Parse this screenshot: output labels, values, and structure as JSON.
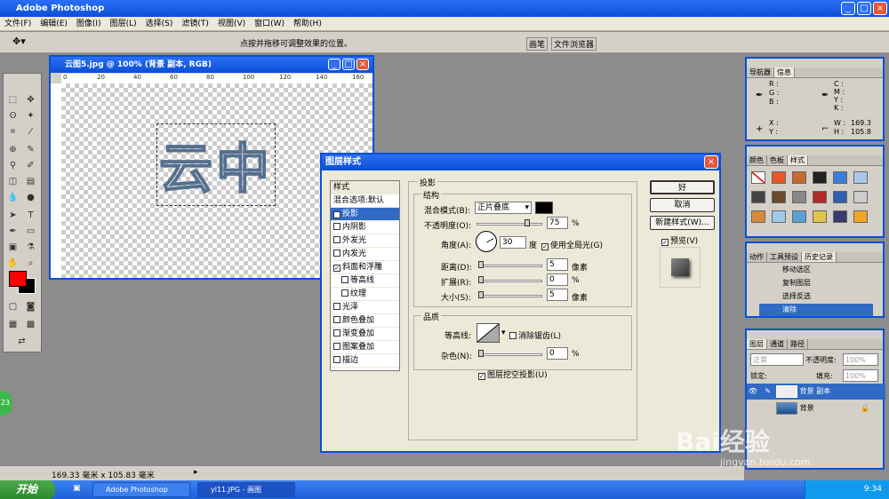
{
  "app": {
    "title": "Adobe Photoshop"
  },
  "menu": [
    "文件(F)",
    "编辑(E)",
    "图像(I)",
    "图层(L)",
    "选择(S)",
    "滤镜(T)",
    "视图(V)",
    "窗口(W)",
    "帮助(H)"
  ],
  "options": {
    "hint": "点按并拖移可调整效果的位置。",
    "tab_brush": "画笔",
    "tab_filebrowser": "文件浏览器"
  },
  "document": {
    "title": "云图5.jpg @ 100% (背景 副本, RGB)",
    "ruler": [
      "0",
      "20",
      "40",
      "60",
      "80",
      "100",
      "120",
      "140",
      "160"
    ],
    "art_text": "云中"
  },
  "dialog": {
    "title": "图层样式",
    "styles_header": "样式",
    "styles": [
      {
        "label": "混合选项:默认",
        "check": false,
        "active": false,
        "indent": false
      },
      {
        "label": "投影",
        "check": true,
        "checked": true,
        "active": true,
        "indent": false
      },
      {
        "label": "内阴影",
        "check": true,
        "checked": false,
        "active": false,
        "indent": false
      },
      {
        "label": "外发光",
        "check": true,
        "checked": false,
        "active": false,
        "indent": false
      },
      {
        "label": "内发光",
        "check": true,
        "checked": false,
        "active": false,
        "indent": false
      },
      {
        "label": "斜面和浮雕",
        "check": true,
        "checked": true,
        "active": false,
        "indent": false
      },
      {
        "label": "等高线",
        "check": true,
        "checked": false,
        "active": false,
        "indent": true
      },
      {
        "label": "纹理",
        "check": true,
        "checked": false,
        "active": false,
        "indent": true
      },
      {
        "label": "光泽",
        "check": true,
        "checked": false,
        "active": false,
        "indent": false
      },
      {
        "label": "颜色叠加",
        "check": true,
        "checked": false,
        "active": false,
        "indent": false
      },
      {
        "label": "渐变叠加",
        "check": true,
        "checked": false,
        "active": false,
        "indent": false
      },
      {
        "label": "图案叠加",
        "check": true,
        "checked": false,
        "active": false,
        "indent": false
      },
      {
        "label": "描边",
        "check": true,
        "checked": false,
        "active": false,
        "indent": false
      }
    ],
    "section": "投影",
    "structure": "结构",
    "blend_label": "混合模式(B):",
    "blend_value": "正片叠底",
    "opacity_label": "不透明度(O):",
    "opacity_value": "75",
    "percent": "%",
    "angle_label": "角度(A):",
    "angle_value": "30",
    "degree": "度",
    "global_light": "使用全局光(G)",
    "distance_label": "距离(D):",
    "distance_value": "5",
    "pixel": "像素",
    "spread_label": "扩展(R):",
    "spread_value": "0",
    "size_label": "大小(S):",
    "size_value": "5",
    "quality": "品质",
    "contour_label": "等高线:",
    "antialias": "消除锯齿(L)",
    "noise_label": "杂色(N):",
    "noise_value": "0",
    "knockout": "图层挖空投影(U)",
    "ok": "好",
    "cancel": "取消",
    "new_style": "新建样式(W)...",
    "preview": "预览(V)"
  },
  "panels": {
    "nav_tabs": [
      "导航器",
      "信息"
    ],
    "info_left": [
      "R :",
      "G :",
      "B :",
      "X :",
      "Y :"
    ],
    "info_right": [
      "C :",
      "M :",
      "Y :",
      "K :",
      "W :",
      "H :"
    ],
    "info_w": "169.3",
    "info_h": "105.8",
    "color_tabs": [
      "颜色",
      "色板",
      "样式"
    ],
    "history_tabs": [
      "动作",
      "工具预设",
      "历史记录"
    ],
    "history": [
      "移动选区",
      "复制图层",
      "选择反选",
      "清除"
    ],
    "layers_tabs": [
      "图层",
      "通道",
      "路径"
    ],
    "layer_mode": "正常",
    "layer_opacity_label": "不透明度:",
    "layer_opacity": "100%",
    "lock_label": "锁定:",
    "fill_label": "填充:",
    "fill_value": "100%",
    "layers": [
      "背景 副本",
      "背景"
    ]
  },
  "status": {
    "size": "169.33 毫米 x 105.83 毫米"
  },
  "taskbar": {
    "start": "开始",
    "items": [
      "Adobe Photoshop",
      "yl11.JPG - 画图"
    ],
    "clock": "9:34"
  },
  "misc": {
    "badge": "23",
    "watermark": "Bai经验",
    "watermark_url": "jingyan.baidu.com"
  },
  "colors": {
    "xp_blue": "#0b4fd6",
    "foreground": "#ff0000",
    "background": "#000000",
    "shadow_color": "#000000"
  }
}
